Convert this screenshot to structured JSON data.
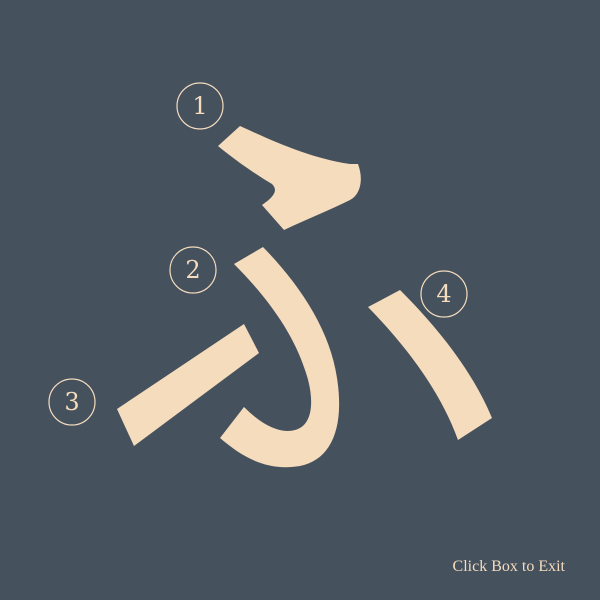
{
  "kana": {
    "character": "ふ",
    "color": "#f5dcbd",
    "background": "#46515e",
    "strokes": [
      {
        "order": "1"
      },
      {
        "order": "2"
      },
      {
        "order": "3"
      },
      {
        "order": "4"
      }
    ]
  },
  "footer": {
    "exit_label": "Click Box to Exit"
  }
}
